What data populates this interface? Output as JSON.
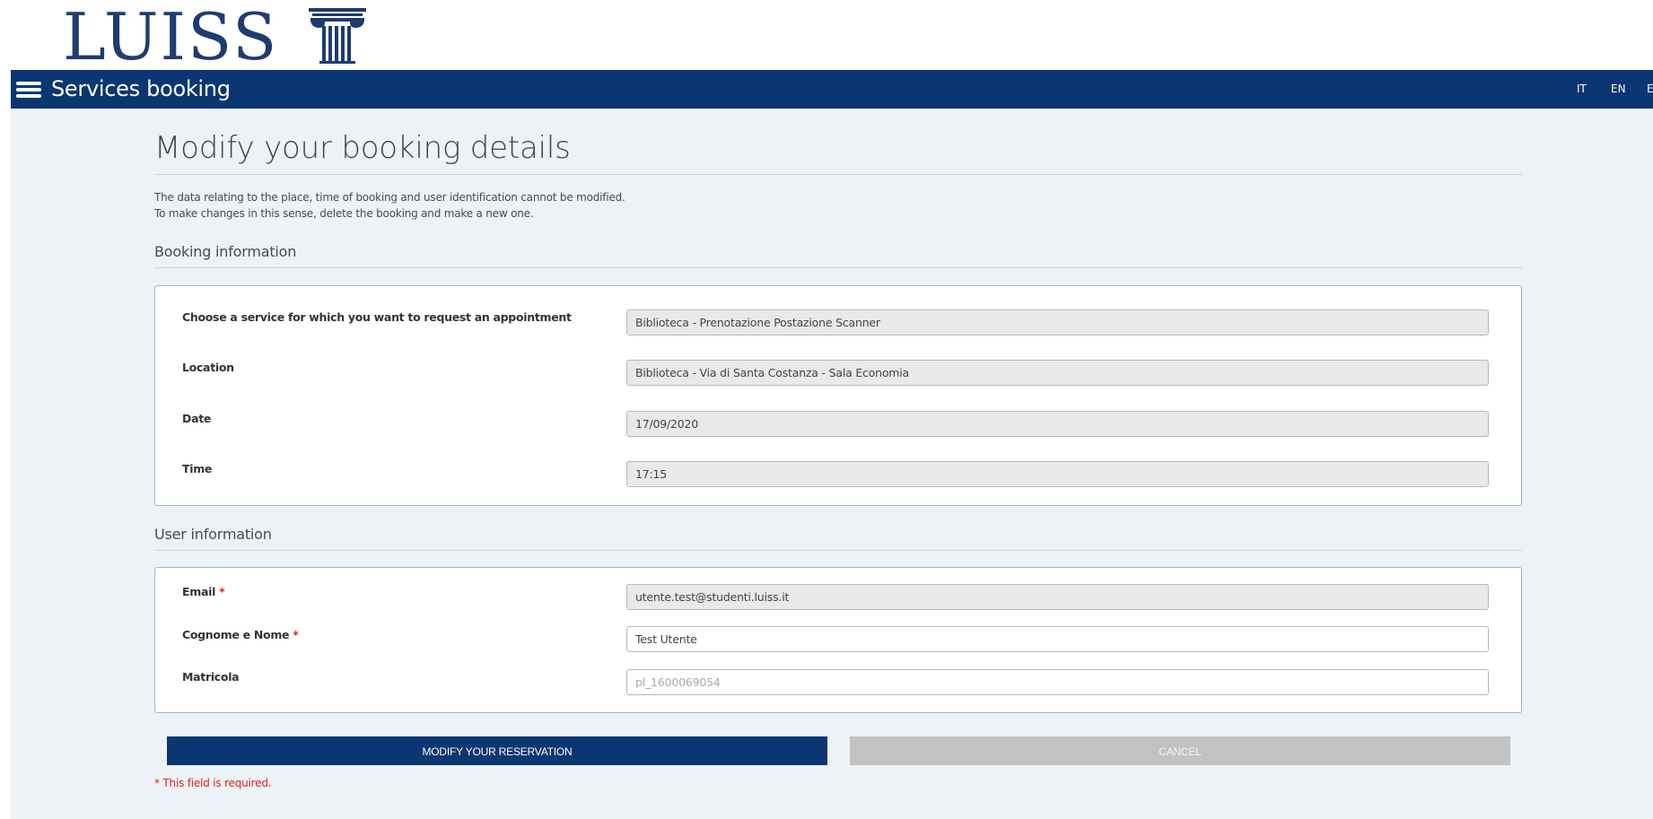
{
  "logo": {
    "text": "LUISS",
    "icon": "column-icon"
  },
  "header": {
    "title": "Services booking",
    "menu_icon": "hamburger-menu-icon",
    "languages": [
      "IT",
      "EN",
      "E"
    ]
  },
  "page": {
    "title": "Modify your booking details",
    "note_line1": "The data relating to the place, time of booking and user identification cannot be modified.",
    "note_line2": "To make changes in this sense, delete the booking and make a new one."
  },
  "booking_section": {
    "title": "Booking information",
    "fields": [
      {
        "label": "Choose a service for which you want to request an appointment",
        "value": "Biblioteca - Prenotazione Postazione Scanner"
      },
      {
        "label": "Location",
        "value": "Biblioteca - Via di Santa Costanza - Sala Economia"
      },
      {
        "label": "Date",
        "value": "17/09/2020"
      },
      {
        "label": "Time",
        "value": "17:15"
      }
    ]
  },
  "user_section": {
    "title": "User information",
    "email": {
      "label": "Email",
      "required_mark": "*",
      "value": "utente.test@studenti.luiss.it"
    },
    "name": {
      "label": "Cognome e Nome",
      "required_mark": "*",
      "value": "Test Utente"
    },
    "matricola": {
      "label": "Matricola",
      "placeholder": "pl_1600069054"
    }
  },
  "actions": {
    "modify_label": "MODIFY YOUR RESERVATION",
    "cancel_label": "CANCEL"
  },
  "required_note": "* This field is required.",
  "colors": {
    "brand": "#0a3771",
    "background": "#ecf2f5",
    "required": "#e02020"
  }
}
